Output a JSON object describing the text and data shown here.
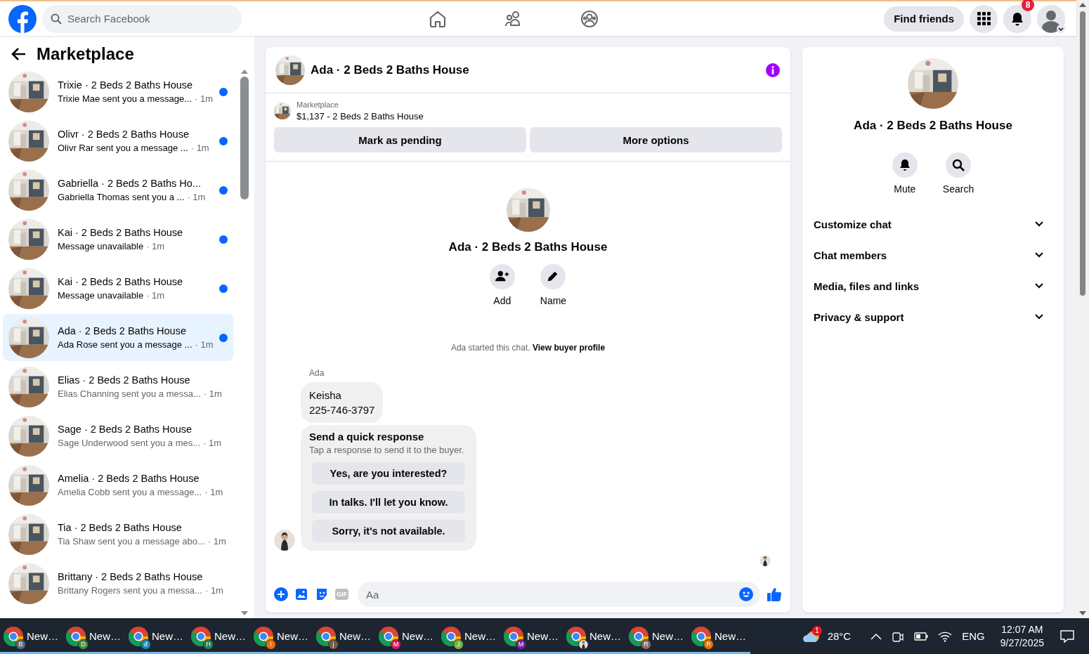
{
  "topbar": {
    "search": {
      "placeholder": "Search Facebook"
    },
    "find_friends": "Find friends",
    "notification_count": "8"
  },
  "sidebar": {
    "title": "Marketplace",
    "conversations": [
      {
        "title": "Trixie · 2 Beds 2 Baths House",
        "preview": "Trixie Mae sent you a message...",
        "time": "· 1m",
        "unread": true,
        "selected": false
      },
      {
        "title": "Olivr · 2 Beds 2 Baths House",
        "preview": "Olivr Rar sent you a message ...",
        "time": "· 1m",
        "unread": true,
        "selected": false
      },
      {
        "title": "Gabriella · 2 Beds 2 Baths Ho...",
        "preview": "Gabriella Thomas sent you a ...",
        "time": "· 1m",
        "unread": true,
        "selected": false
      },
      {
        "title": "Kai · 2 Beds 2 Baths House",
        "preview": "Message unavailable",
        "time": "· 1m",
        "unread": true,
        "selected": false
      },
      {
        "title": "Kai · 2 Beds 2 Baths House",
        "preview": "Message unavailable",
        "time": "· 1m",
        "unread": true,
        "selected": false
      },
      {
        "title": "Ada · 2 Beds 2 Baths House",
        "preview": "Ada Rose sent you a message ...",
        "time": "· 1m",
        "unread": true,
        "selected": true
      },
      {
        "title": "Elias · 2 Beds 2 Baths House",
        "preview": "Elias Channing sent you a messa...",
        "time": "· 1m",
        "unread": false,
        "selected": false
      },
      {
        "title": "Sage · 2 Beds 2 Baths House",
        "preview": "Sage Underwood sent you a mes...",
        "time": "· 1m",
        "unread": false,
        "selected": false
      },
      {
        "title": "Amelia · 2 Beds 2 Baths House",
        "preview": "Amelia Cobb sent you a message...",
        "time": "· 1m",
        "unread": false,
        "selected": false
      },
      {
        "title": "Tia · 2 Beds 2 Baths House",
        "preview": "Tia Shaw sent you a message abo...",
        "time": "· 1m",
        "unread": false,
        "selected": false
      },
      {
        "title": "Brittany · 2 Beds 2 Baths House",
        "preview": "Brittany Rogers sent you a messa...",
        "time": "· 1m",
        "unread": false,
        "selected": false
      }
    ]
  },
  "chat": {
    "title": "Ada · 2 Beds 2 Baths House",
    "listing": {
      "source": "Marketplace",
      "label": "$1,137 - 2 Beds 2 Baths House"
    },
    "actions": [
      "Mark as pending",
      "More options"
    ],
    "intro": {
      "title": "Ada · 2 Beds 2 Baths House",
      "buttons": [
        {
          "label": "Add",
          "kind": "add"
        },
        {
          "label": "Name",
          "kind": "name"
        }
      ]
    },
    "notice": {
      "text": "Ada started this chat.",
      "link": "View buyer profile"
    },
    "message": {
      "sender": "Ada",
      "lines": [
        "Keisha",
        "225-746-3797"
      ]
    },
    "quick_response": {
      "title": "Send a quick response",
      "subtitle": "Tap a response to send it to the buyer.",
      "options": [
        "Yes, are you interested?",
        "In talks. I'll let you know.",
        "Sorry, it's not available."
      ]
    },
    "composer": {
      "gif": "GIF",
      "placeholder": "Aa"
    }
  },
  "details": {
    "title": "Ada · 2 Beds 2 Baths House",
    "actions": [
      {
        "label": "Mute",
        "kind": "mute"
      },
      {
        "label": "Search",
        "kind": "search"
      }
    ],
    "sections": [
      {
        "label": "Customize chat",
        "expanded": false
      },
      {
        "label": "Chat members",
        "expanded": false
      },
      {
        "label": "Media, files and links",
        "expanded": false
      },
      {
        "label": "Privacy & support",
        "expanded": false
      }
    ]
  },
  "taskbar": {
    "windows": [
      {
        "label": "New…",
        "badge": "B",
        "color": "#5f6b7a"
      },
      {
        "label": "New…",
        "badge": "D",
        "color": "#4a8f3c"
      },
      {
        "label": "New…",
        "badge": "d",
        "color": "#1a8bb0"
      },
      {
        "label": "New…",
        "badge": "H",
        "color": "#2e7d5b"
      },
      {
        "label": "New…",
        "badge": "I",
        "color": "#e8710a"
      },
      {
        "label": "New…",
        "badge": "j",
        "color": "#7a5a48"
      },
      {
        "label": "New…",
        "badge": "M",
        "color": "#d81b60"
      },
      {
        "label": "New…",
        "badge": "J",
        "color": "#7cb342"
      },
      {
        "label": "New…",
        "badge": "M",
        "color": "#7b1fa2"
      },
      {
        "label": "New…",
        "kind": "picture"
      },
      {
        "label": "New…",
        "badge": "R",
        "color": "#8d6e63"
      },
      {
        "label": "New…",
        "badge": "R",
        "color": "#e8710a"
      }
    ],
    "weather": {
      "badge": "1",
      "temperature": "28°C"
    },
    "language": "ENG",
    "time": "12:07 AM",
    "date": "9/27/2025"
  }
}
